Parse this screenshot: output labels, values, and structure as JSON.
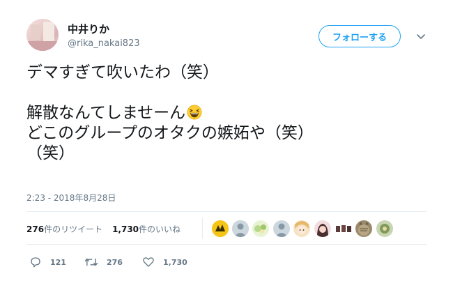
{
  "user": {
    "display_name": "中井りか",
    "handle": "@rika_nakai823"
  },
  "follow_button": {
    "label": "フォローする"
  },
  "tweet": {
    "lines": [
      "デマすぎて吹いたわ（笑）",
      "",
      "解散なんてしませーん",
      "どこのグループのオタクの嫉妬や（笑）",
      "（笑）"
    ],
    "emoji": "grinning-squinting-face"
  },
  "timestamp": "2:23 - 2018年8月28日",
  "stats": {
    "retweets_count": "276",
    "retweets_label": "件のリツイート",
    "likes_count": "1,730",
    "likes_label": "件のいいね"
  },
  "likers": [
    "liker-avatar-1",
    "liker-avatar-2",
    "liker-avatar-3",
    "liker-avatar-4",
    "liker-avatar-5",
    "liker-avatar-6",
    "liker-avatar-7",
    "liker-avatar-8",
    "liker-avatar-9"
  ],
  "actions": {
    "reply_count": "121",
    "retweet_count": "276",
    "like_count": "1,730"
  },
  "colors": {
    "accent": "#1da1f2",
    "secondary_text": "#657786",
    "divider": "#e6ecf0"
  }
}
